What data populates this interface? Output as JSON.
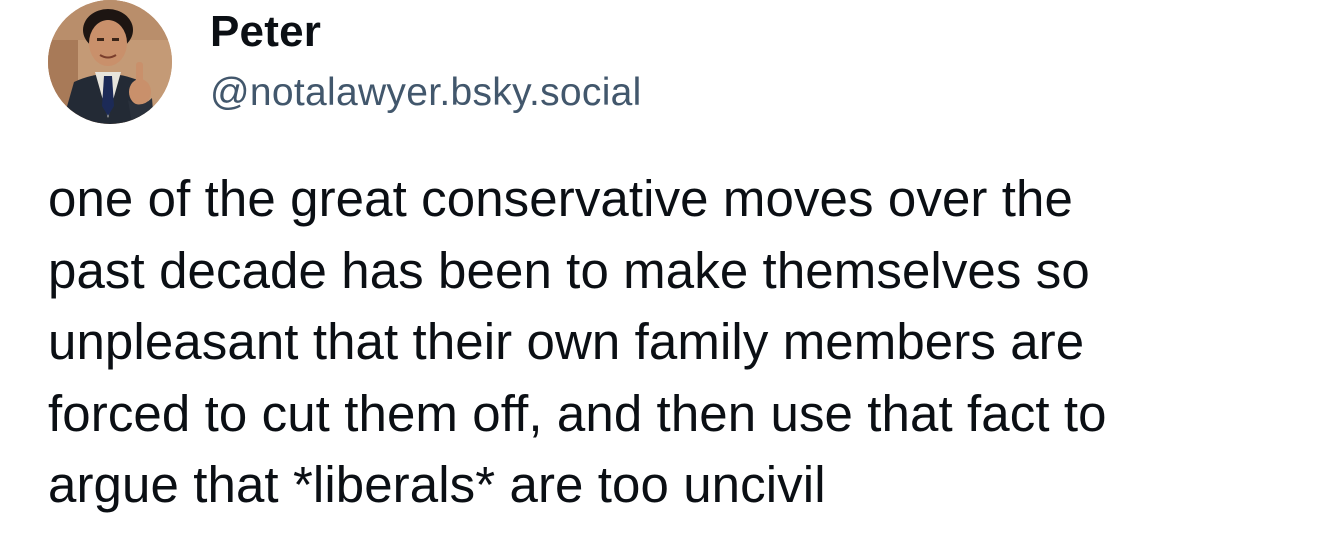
{
  "author": {
    "display_name": "Peter",
    "handle": "@notalawyer.bsky.social",
    "avatar_icon": "profile-photo-avatar"
  },
  "post": {
    "lines": [
      "one of the great conservative moves over the",
      "past decade has been to make themselves so",
      "unpleasant that their own family members are",
      "forced to cut them off, and then use that fact to",
      "argue that *liberals* are too uncivil"
    ]
  },
  "colors": {
    "text": "#0b0f14",
    "handle": "#42576c",
    "background": "#ffffff"
  }
}
